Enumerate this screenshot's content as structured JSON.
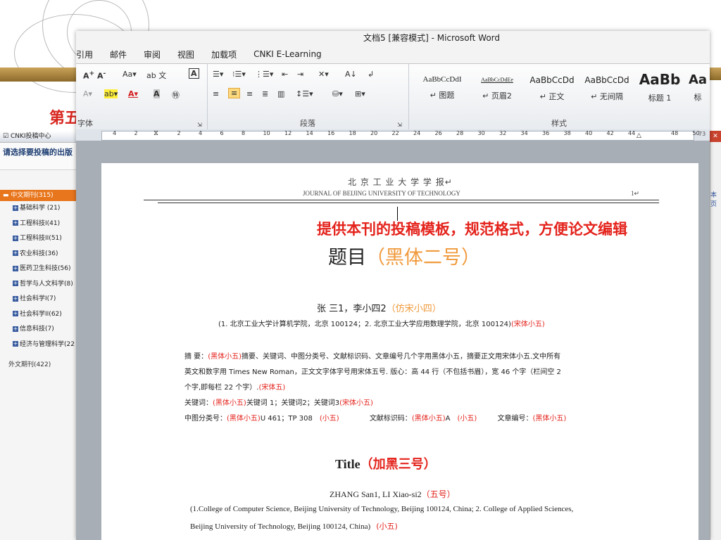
{
  "slide": {
    "title": "第五",
    "overlay_caption": "提供本刊的投稿模板，规范格式，方便论文编辑"
  },
  "cnki": {
    "window_title": "CNKI投稿中心",
    "prompt": "请选择要投稿的出版",
    "tree_root": "中文期刊(315)",
    "categories": [
      "基础科学 (21)",
      "工程科技I(41)",
      "工程科技II(51)",
      "农业科技(36)",
      "医药卫生科技(56)",
      "哲学与人文科学(8)",
      "社会科学I(7)",
      "社会科学II(62)",
      "信息科技(7)",
      "经济与管理科学(22"
    ],
    "foreign": "外文期刊(422)",
    "right_fragment": "本页",
    "close_icon": "close-icon"
  },
  "word": {
    "title": "文档5 [兼容模式] - Microsoft Word",
    "tabs": [
      "引用",
      "邮件",
      "审阅",
      "视图",
      "加载项",
      "CNKI E-Learning"
    ],
    "font_group_label": "字体",
    "paragraph_group_label": "段落",
    "styles_group_label": "样式",
    "styles": [
      {
        "sample": "AaBbCcDdI",
        "name": "↵ 图题"
      },
      {
        "sample": "AaBbCcDdEe",
        "name": "↵ 页眉2"
      },
      {
        "sample": "AaBbCcDd",
        "name": "↵ 正文"
      },
      {
        "sample": "AaBbCcDd",
        "name": "↵ 无间隔"
      },
      {
        "sample": "AaBb",
        "name": "标题 1"
      },
      {
        "sample": "Aa",
        "name": "标"
      }
    ],
    "ruler_numbers": [
      "4",
      "2",
      "",
      "2",
      "4",
      "6",
      "8",
      "10",
      "12",
      "14",
      "16",
      "18",
      "20",
      "22",
      "24",
      "26",
      "28",
      "30",
      "32",
      "34",
      "36",
      "38",
      "40",
      "42",
      "44",
      "",
      "48",
      "50"
    ],
    "ruler_right": "73"
  },
  "doc": {
    "header_cn": "北 京 工 业 大 学 学 报↵",
    "header_en": "JOURNAL OF BEIJING UNIVERSITY OF TECHNOLOGY",
    "page_num": "1↵",
    "title_main": "题目",
    "title_note": "（黑体二号）",
    "authors": "张  三1，李小四2",
    "authors_note": "（仿宋小四）",
    "affiliation": "(1. 北京工业大学计算机学院，北京  100124；2. 北京工业大学应用数理学院，北京  100124)",
    "affiliation_note": "(宋体小五)",
    "abstract_label": "摘    要：",
    "abstract_note": "(黑体小五)",
    "abstract_line1": "摘要、关键词、中图分类号、文献标识码、文章编号几个字用黑体小五，摘要正文用宋体小五.文中所有",
    "abstract_line2": "英文和数字用 Times  New  Roman，正文文字体字号用宋体五号.  版心：高 44 行（不包括书眉），宽 46 个字（栏间空 2",
    "abstract_line3": "个字,即每栏 22 个字）.",
    "abstract_line3_note": "(宋体五)",
    "keywords_label": "关键词：",
    "keywords_note1": "(黑体小五)",
    "keywords_text": "关键词 1；关键词2；关键词3",
    "keywords_note2": "(宋体小五)",
    "clc_label": "中图分类号：",
    "clc_note1": "(黑体小五)",
    "clc_text": "U 461；TP 308",
    "clc_note2": "(小五)",
    "doccode_label": "文献标识码：",
    "doccode_note1": "(黑体小五)",
    "doccode_text": "A",
    "doccode_note2": "(小五)",
    "articleno_label": "文章编号：",
    "articleno_note": "(黑体小五)",
    "en_title": "Title",
    "en_title_note": "（加黑三号）",
    "en_authors": "ZHANG San1, LI Xiao-si2",
    "en_authors_note": "（五号）",
    "en_affil1": "(1.College of Computer Science, Beijing University of Technology, Beijing 100124, China; 2. College of Applied Sciences,",
    "en_affil2": "Beijing University of Technology, Beijing 100124, China)",
    "en_affil_note": "(小五)"
  }
}
